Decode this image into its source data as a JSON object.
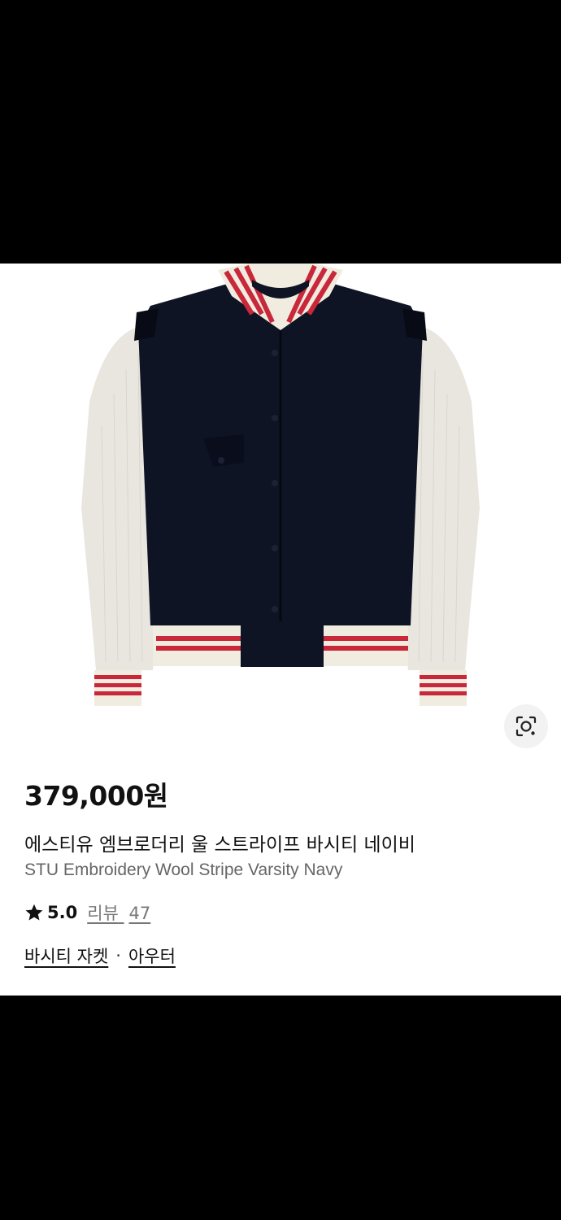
{
  "product": {
    "price": "379,000원",
    "title_ko": "에스티유 엠브로더리 울 스트라이프 바시티 네이비",
    "title_en": "STU Embroidery Wool Stripe Varsity Navy",
    "rating": "5.0",
    "review_label": "리뷰",
    "review_count": "47",
    "categories": [
      "바시티 자켓",
      "아우터"
    ],
    "category_separator": "·",
    "image_icon": "varsity-jacket-image",
    "lens_icon": "visual-search-icon"
  },
  "colors": {
    "body": "#0f1424",
    "sleeve": "#e8e5df",
    "stripe_red": "#c8283a",
    "stripe_cream": "#f1ece0"
  }
}
